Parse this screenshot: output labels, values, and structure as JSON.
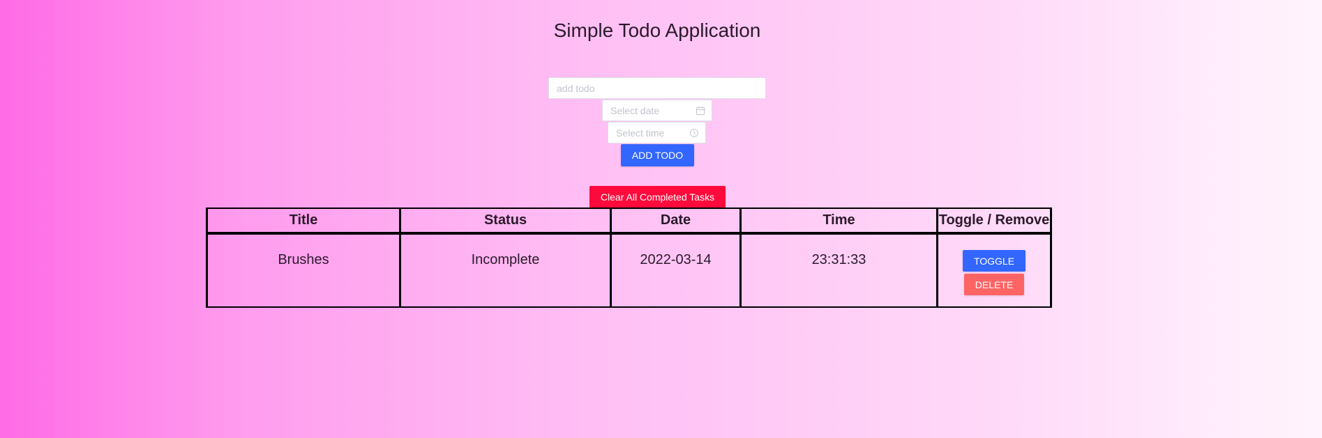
{
  "app": {
    "title": "Simple Todo Application"
  },
  "form": {
    "todo_placeholder": "add todo",
    "todo_value": "",
    "date_placeholder": "Select date",
    "date_value": "",
    "time_placeholder": "Select time",
    "time_value": "",
    "add_button_label": "ADD TODO",
    "date_icon": "calendar-icon",
    "time_icon": "clock-icon"
  },
  "clear_button_label": "Clear All Completed Tasks",
  "table": {
    "headers": [
      "Title",
      "Status",
      "Date",
      "Time",
      "Toggle / Remove"
    ],
    "rows": [
      {
        "title": "Brushes",
        "status": "Incomplete",
        "date": "2022-03-14",
        "time": "23:31:33",
        "toggle_label": "TOGGLE",
        "delete_label": "DELETE"
      }
    ]
  },
  "colors": {
    "primary": "#3366ff",
    "danger": "#ff0a3c",
    "delete": "#ff6464"
  }
}
